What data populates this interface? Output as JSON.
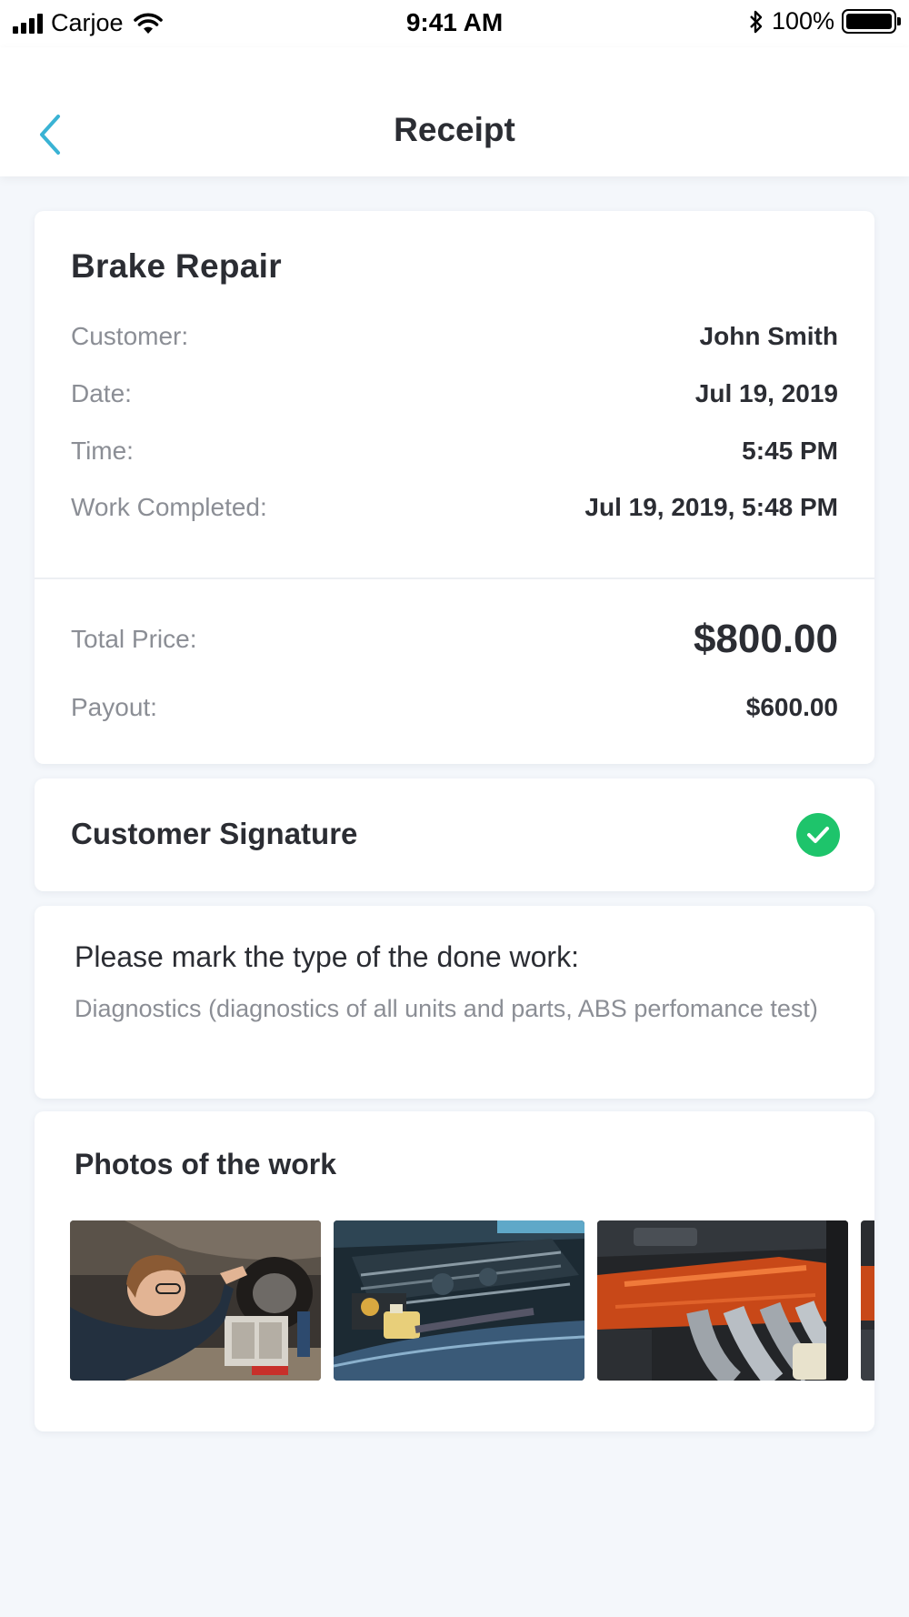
{
  "status_bar": {
    "carrier": "Carjoe",
    "time": "9:41 AM",
    "battery": "100%"
  },
  "nav": {
    "title": "Receipt",
    "back_icon": "chevron-left-icon"
  },
  "job": {
    "title": "Brake Repair",
    "details": [
      {
        "label": "Customer:",
        "value": "John Smith"
      },
      {
        "label": "Date:",
        "value": "Jul 19, 2019"
      },
      {
        "label": "Time:",
        "value": "5:45 PM"
      },
      {
        "label": "Work Completed:",
        "value": "Jul 19, 2019, 5:48 PM"
      }
    ],
    "total_label": "Total Price:",
    "total_value": "$800.00",
    "payout_label": "Payout:",
    "payout_value": "$600.00"
  },
  "signature": {
    "title": "Customer Signature",
    "status_icon": "check-circle-icon",
    "status_color": "#1ec46b"
  },
  "work_type": {
    "title": "Please mark the type of the done work:",
    "description": "Diagnostics (diagnostics of all units and parts, ABS perfomance test)"
  },
  "photos": {
    "title": "Photos of the work",
    "items": [
      "mechanic-under-car-photo",
      "engine-bay-photo",
      "orange-engine-photo",
      "engine-photo-partial"
    ]
  },
  "colors": {
    "accent": "#3ab3d4",
    "background": "#f4f7fb"
  }
}
